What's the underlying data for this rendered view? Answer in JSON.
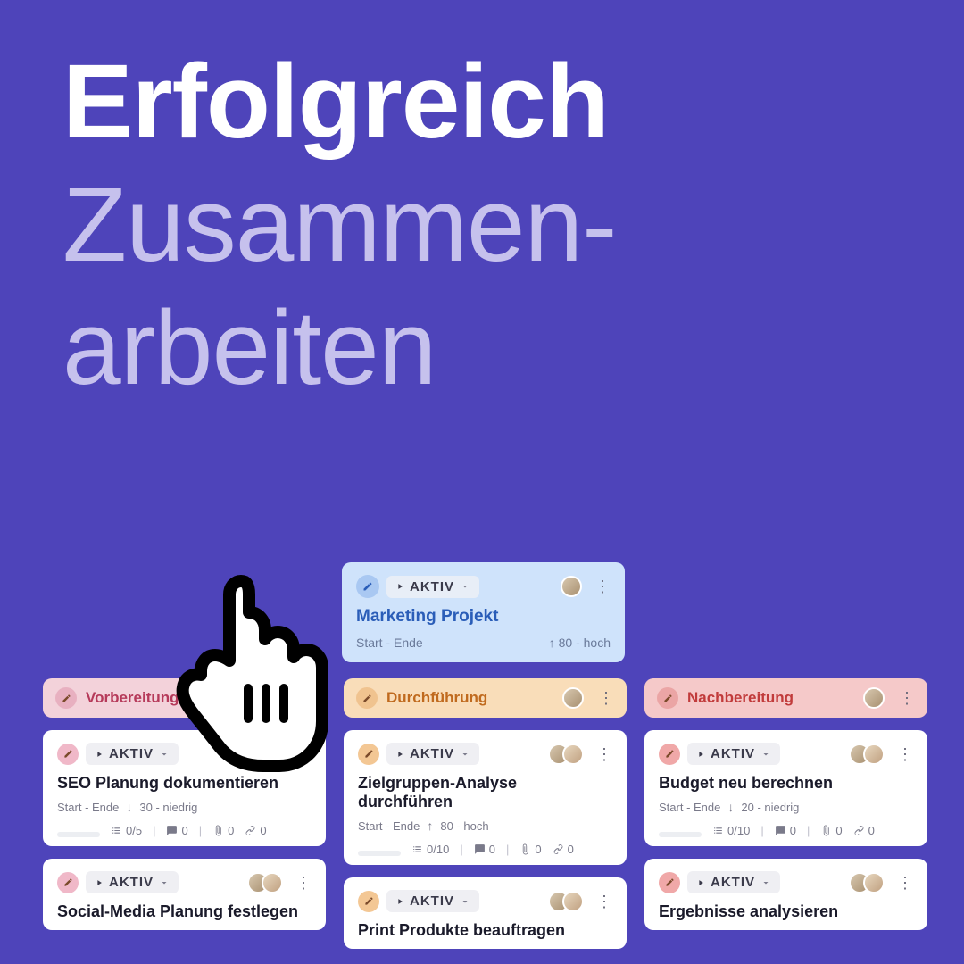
{
  "headline": {
    "line1": "Erfolgreich",
    "line2": "Zusammen-",
    "line3": "arbeiten"
  },
  "project": {
    "status": "AKTIV",
    "title": "Marketing Projekt",
    "range": "Start - Ende",
    "priority_arrow": "↑",
    "priority": "80 - hoch"
  },
  "columns": [
    {
      "key": "vorbereitung",
      "title": "Vorbereitung",
      "color": "pink",
      "show_avatar": false,
      "cards": [
        {
          "status": "AKTIV",
          "title": "SEO Planung dokumentieren",
          "range": "Start - Ende",
          "priority_arrow": "↓",
          "priority": "30 - niedrig",
          "checklist": "0/5",
          "comments": "0",
          "attachments": "0",
          "links": "0"
        },
        {
          "status": "AKTIV",
          "title": "Social-Media Planung festlegen"
        }
      ]
    },
    {
      "key": "durchfuehrung",
      "title": "Durchführung",
      "color": "orange",
      "show_avatar": true,
      "cards": [
        {
          "status": "AKTIV",
          "title": "Zielgruppen-Analyse durchführen",
          "range": "Start - Ende",
          "priority_arrow": "↑",
          "priority": "80 - hoch",
          "checklist": "0/10",
          "comments": "0",
          "attachments": "0",
          "links": "0"
        },
        {
          "status": "AKTIV",
          "title": "Print Produkte beauftragen"
        }
      ]
    },
    {
      "key": "nachbereitung",
      "title": "Nachbereitung",
      "color": "red",
      "show_avatar": true,
      "cards": [
        {
          "status": "AKTIV",
          "title": "Budget neu berechnen",
          "range": "Start - Ende",
          "priority_arrow": "↓",
          "priority": "20 - niedrig",
          "checklist": "0/10",
          "comments": "0",
          "attachments": "0",
          "links": "0"
        },
        {
          "status": "AKTIV",
          "title": "Ergebnisse analysieren"
        }
      ]
    }
  ]
}
